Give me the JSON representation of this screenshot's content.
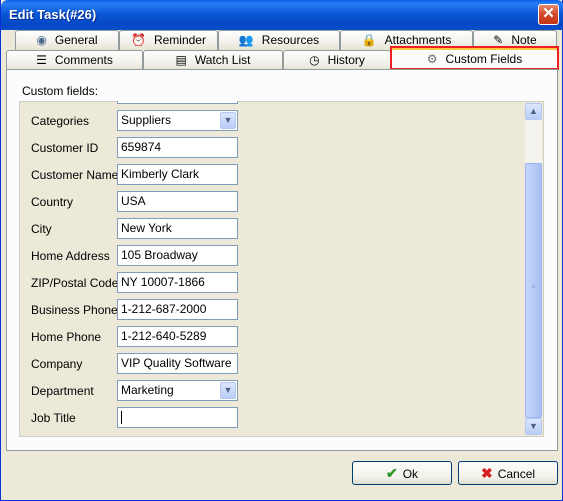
{
  "window": {
    "title": "Edit Task(#26)",
    "close_glyph": "✕"
  },
  "tabs_row1": [
    {
      "label": "General",
      "icon": "globe-icon",
      "glyph": "◉"
    },
    {
      "label": "Reminder",
      "icon": "alarm-clock-icon",
      "glyph": "⏰"
    },
    {
      "label": "Resources",
      "icon": "people-icon",
      "glyph": "👥"
    },
    {
      "label": "Attachments",
      "icon": "padlock-icon",
      "glyph": "🔒"
    },
    {
      "label": "Note",
      "icon": "note-pencil-icon",
      "glyph": "✎"
    }
  ],
  "tabs_row2": [
    {
      "label": "Comments",
      "icon": "comments-icon",
      "glyph": "☰"
    },
    {
      "label": "Watch List",
      "icon": "watch-list-icon",
      "glyph": "▤"
    },
    {
      "label": "History",
      "icon": "history-icon",
      "glyph": "◷"
    },
    {
      "label": "Custom Fields",
      "icon": "gear-icon",
      "glyph": "⚙"
    }
  ],
  "active_tab": "Custom Fields",
  "custom_fields_label": "Custom fields:",
  "fields": [
    {
      "label": "Categories",
      "value": "Suppliers",
      "type": "dropdown"
    },
    {
      "label": "Customer ID",
      "value": "659874",
      "type": "text"
    },
    {
      "label": "Customer Name",
      "value": "Kimberly Clark",
      "type": "text"
    },
    {
      "label": "Country",
      "value": "USA",
      "type": "text"
    },
    {
      "label": "City",
      "value": "New York",
      "type": "text"
    },
    {
      "label": "Home Address",
      "value": "105 Broadway",
      "type": "text"
    },
    {
      "label": "ZIP/Postal Code",
      "value": "NY 10007-1866",
      "type": "text"
    },
    {
      "label": "Business Phone",
      "value": "1-212-687-2000",
      "type": "text"
    },
    {
      "label": "Home Phone",
      "value": "1-212-640-5289",
      "type": "text"
    },
    {
      "label": "Company",
      "value": "VIP Quality Software",
      "type": "text"
    },
    {
      "label": "Department",
      "value": "Marketing",
      "type": "dropdown"
    },
    {
      "label": "Job Title",
      "value": "",
      "type": "text"
    }
  ],
  "buttons": {
    "ok": {
      "label": "Ok",
      "glyph": "✔",
      "color": "#2a9a2a"
    },
    "cancel": {
      "label": "Cancel",
      "glyph": "✖",
      "color": "#d42020"
    }
  },
  "colors": {
    "titlebar": "#0a58d8",
    "tab_highlight": "#ee2020",
    "active_tab_top": "#ffc83c"
  }
}
